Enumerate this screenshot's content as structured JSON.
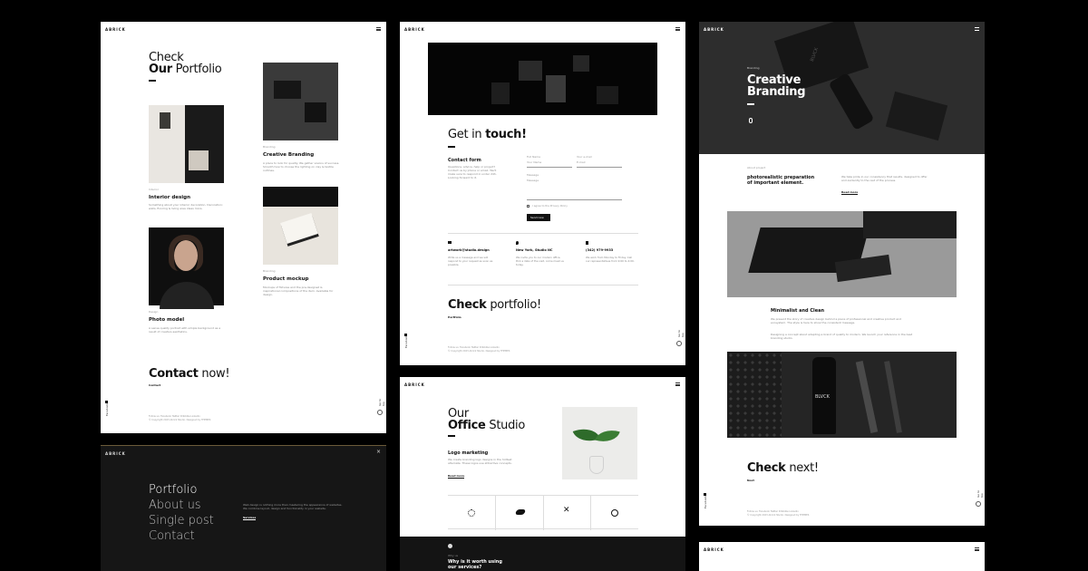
{
  "brand": "ABRICK",
  "portfolio_page": {
    "title_line1": "Check",
    "title_bold": "Our",
    "title_rest": "Portfolio",
    "items": [
      {
        "category": "Interior",
        "title": "Interior design",
        "desc": "Something about your interior decoration. Decoration: walls, flooring & living area ideas more."
      },
      {
        "category": "Branding",
        "title": "Creative Branding",
        "desc": "A place to look for quality. We gather visions of success. Smooth how to choose the lighting on clay & textile outlines."
      },
      {
        "category": "Design",
        "title": "Photo model",
        "desc": "A sense quality portrait with simple background as a result of creative aesthetics."
      },
      {
        "category": "Branding",
        "title": "Product mockup",
        "desc": "Mockups of fixtures and the pre-designed & inspirational compositions of the item. Available for design."
      }
    ],
    "contact_bold": "Contact",
    "contact_rest": "now!",
    "contact_link": "Contact",
    "sidebar_label": "Facebook",
    "scroll_label": "Go to top",
    "footer_links": "Follow us:  Facebook  Twitter  Dribbble  Linkedin",
    "copyright": "© Copyright 2023 Abrick Studio. Designed by THEMES"
  },
  "contact_page": {
    "heading_pre": "Get in",
    "heading_bold": "touch!",
    "form_title": "Contact form",
    "form_desc": "Questions, advice, help or project? Contact us by phone or email. We'll make sure to respond in under 24h. Looking forward to it.",
    "full_name_label": "Full Name",
    "full_name_placeholder": "Your Name",
    "email_label": "Your e-mail",
    "email_placeholder": "E-mail",
    "message_label": "Message",
    "message_placeholder": "Message",
    "agree_text": "I agree to the Privacy Policy",
    "send_label": "Send now",
    "info": [
      {
        "icon": "mail",
        "title": "artwork@studio.design",
        "desc": "Write us a message and we will respond to your request as soon as possible."
      },
      {
        "icon": "location",
        "title": "New York, Studio NC",
        "desc": "We invite you to our modern office. Pick a date of the visit, come meet us today."
      },
      {
        "icon": "phone",
        "title": "(342) 979-9933",
        "desc": "We work from Monday to Friday. Call our representatives from 9:00 to 4:00."
      }
    ],
    "check_bold": "Check",
    "check_rest": "portfolio!",
    "check_link": "Portfolio",
    "sidebar_label": "Facebook",
    "scroll_label": "Go to top",
    "footer_links": "Follow us:  Facebook  Twitter  Dribbble  Linkedin",
    "copyright": "© Copyright 2023 Abrick Studio. Designed by THEMES"
  },
  "branding_page": {
    "category": "Branding",
    "title_line1": "Creative",
    "title_line2": "Branding",
    "detail_label": "About project",
    "detail_title": "photorealistic preparation of important element.",
    "detail_desc": "We take pride in our consistency that results, designed to offer and evidently to the rest of the process.",
    "read_more": "Read more",
    "section_title": "Minimalist and Clean",
    "section_p1": "We present the story of creative design behind a piece of professional and creative product and ecosystem. The style is here to show the consistent message.",
    "section_p2": "Designing a concept about adapting a brand of quality to modern. We launch your reference in the best branding studio.",
    "bottle_label": "BLVCK",
    "box_label": "BLVCK",
    "check_bold": "Check",
    "check_rest": "next!",
    "check_link": "Next",
    "sidebar_label": "Facebook",
    "scroll_label": "Go to top",
    "footer_links": "Follow us:  Facebook  Twitter  Dribbble  Linkedin",
    "copyright": "© Copyright 2023 Abrick Studio. Designed by THEMES"
  },
  "menu_page": {
    "items": [
      "Portfolio",
      "About us",
      "Single post",
      "Contact"
    ],
    "desc": "Web design is nothing more than mastering the appearance of websites. We combine layout, design and functionality in your website.",
    "link": "Services",
    "close": "×"
  },
  "office_page": {
    "title_line1": "Our",
    "title_bold": "Office",
    "title_rest": "Studio",
    "subtitle": "Logo marketing",
    "desc": "We create branding logo designs in the hottest alternate. These logos use attractive concepts.",
    "read_more": "Read more",
    "dark_small": "Why us",
    "dark_title_line1": "Why is it worth using",
    "dark_title_line2": "our services?"
  }
}
